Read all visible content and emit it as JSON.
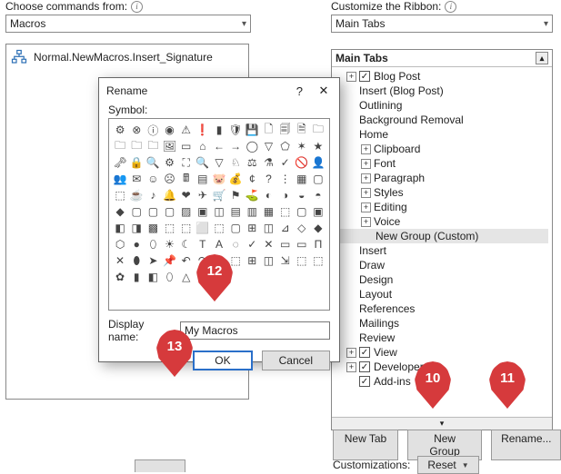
{
  "choose_from_label": "Choose commands from:",
  "choose_from_value": "Macros",
  "customize_ribbon_label": "Customize the Ribbon:",
  "customize_ribbon_value": "Main Tabs",
  "macro_list_item": "Normal.NewMacros.Insert_Signature",
  "main_tabs_header": "Main Tabs",
  "tree": [
    {
      "lvl": 1,
      "exp": "+",
      "chk": true,
      "label": "Blog Post"
    },
    {
      "lvl": 1,
      "exp": "",
      "chk": false,
      "label": "Insert (Blog Post)"
    },
    {
      "lvl": 1,
      "exp": "",
      "chk": false,
      "label": "Outlining"
    },
    {
      "lvl": 1,
      "exp": "",
      "chk": false,
      "label": "Background Removal"
    },
    {
      "lvl": 1,
      "exp": "",
      "chk": false,
      "label": "Home"
    },
    {
      "lvl": 2,
      "exp": "+",
      "chk": false,
      "label": "Clipboard"
    },
    {
      "lvl": 2,
      "exp": "+",
      "chk": false,
      "label": "Font"
    },
    {
      "lvl": 2,
      "exp": "+",
      "chk": false,
      "label": "Paragraph"
    },
    {
      "lvl": 2,
      "exp": "+",
      "chk": false,
      "label": "Styles"
    },
    {
      "lvl": 2,
      "exp": "+",
      "chk": false,
      "label": "Editing"
    },
    {
      "lvl": 2,
      "exp": "+",
      "chk": false,
      "label": "Voice"
    },
    {
      "lvl": 3,
      "exp": "",
      "chk": false,
      "label": "New Group (Custom)",
      "sel": true
    },
    {
      "lvl": 1,
      "exp": "",
      "chk": false,
      "label": "Insert"
    },
    {
      "lvl": 1,
      "exp": "",
      "chk": false,
      "label": "Draw"
    },
    {
      "lvl": 1,
      "exp": "",
      "chk": false,
      "label": "Design"
    },
    {
      "lvl": 1,
      "exp": "",
      "chk": false,
      "label": "Layout"
    },
    {
      "lvl": 1,
      "exp": "",
      "chk": false,
      "label": "References"
    },
    {
      "lvl": 1,
      "exp": "",
      "chk": false,
      "label": "Mailings"
    },
    {
      "lvl": 1,
      "exp": "",
      "chk": false,
      "label": "Review"
    },
    {
      "lvl": 1,
      "exp": "+",
      "chk": true,
      "label": "View"
    },
    {
      "lvl": 1,
      "exp": "+",
      "chk": true,
      "label": "Developer"
    },
    {
      "lvl": 1,
      "exp": "",
      "chk": true,
      "label": "Add-ins"
    }
  ],
  "new_tab_btn": "New Tab",
  "new_group_btn": "New Group",
  "rename_btn": "Rename...",
  "customizations_label": "Customizations:",
  "reset_btn": "Reset",
  "dialog": {
    "title": "Rename",
    "symbol_label": "Symbol:",
    "display_name_label": "Display name:",
    "display_name_value": "My Macros",
    "ok": "OK",
    "cancel": "Cancel"
  },
  "callouts": {
    "c10": "10",
    "c11": "11",
    "c12": "12",
    "c13": "13"
  },
  "symbols": [
    "⚙",
    "⊗",
    "ⓘ",
    "◉",
    "⚠",
    "❗",
    "▮",
    "🛡",
    "💾",
    "🗋",
    "🗐",
    "🗎",
    "🗀",
    "🗀",
    "🗀",
    "🗀",
    "🖼",
    "▭",
    "⌂",
    "←",
    "→",
    "◯",
    "▽",
    "⬠",
    "✶",
    "★",
    "🗝",
    "🔒",
    "🔍",
    "⚙",
    "⛶",
    "🔍",
    "▽",
    "♘",
    "⚖",
    "⚗",
    "✓",
    "🚫",
    "👤",
    "👥",
    "✉",
    "☺",
    "☹",
    "🖩",
    "▤",
    "🐷",
    "💰",
    "¢",
    "?",
    "⋮",
    "▦",
    "▢",
    "⬚",
    "☕",
    "♪",
    "🔔",
    "❤",
    "✈",
    "🛒",
    "⚑",
    "⛳",
    "◐",
    "◑",
    "◒",
    "◓",
    "◆",
    "▢",
    "▢",
    "▢",
    "▨",
    "▣",
    "◫",
    "▤",
    "▥",
    "▦",
    "⬚",
    "▢",
    "▣",
    "◧",
    "◨",
    "▩",
    "⬚",
    "⬚",
    "⬜",
    "⬚",
    "▢",
    "⊞",
    "◫",
    "⊿",
    "◇",
    "◆",
    "⬡",
    "●",
    "⬯",
    "☀",
    "☾",
    "T",
    "A",
    "◌",
    "✓",
    "✕",
    "▭",
    "▭",
    "Π",
    "✕",
    "⬮",
    "➤",
    "📌",
    "↶",
    "↷",
    "◌",
    "⬚",
    "⊞",
    "◫",
    "⇲",
    "⬚",
    "⬚",
    "✿",
    "▮",
    "◧",
    "⬯",
    "△"
  ]
}
